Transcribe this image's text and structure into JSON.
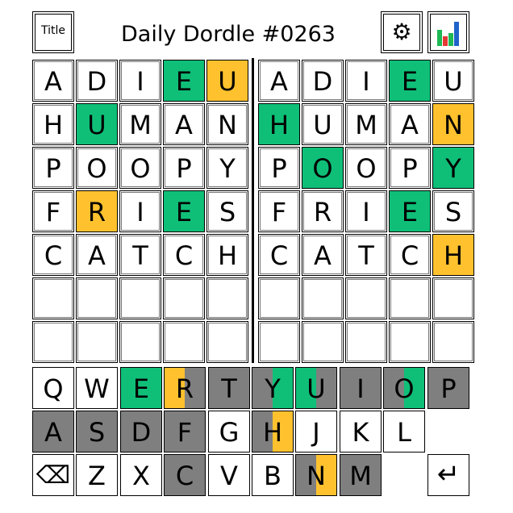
{
  "header": {
    "title_button_label": "Title",
    "game_title": "Daily Dordle #0263",
    "settings_icon": "gear-icon",
    "stats_icon": "bar-chart-icon"
  },
  "colors": {
    "green": "#0fbf78",
    "yellow": "#ffc22e",
    "gray": "#7f7f7f",
    "white": "#ffffff"
  },
  "boards": [
    {
      "rows": [
        [
          {
            "l": "A",
            "s": "none"
          },
          {
            "l": "D",
            "s": "none"
          },
          {
            "l": "I",
            "s": "none"
          },
          {
            "l": "E",
            "s": "green"
          },
          {
            "l": "U",
            "s": "yellow"
          }
        ],
        [
          {
            "l": "H",
            "s": "none"
          },
          {
            "l": "U",
            "s": "green"
          },
          {
            "l": "M",
            "s": "none"
          },
          {
            "l": "A",
            "s": "none"
          },
          {
            "l": "N",
            "s": "none"
          }
        ],
        [
          {
            "l": "P",
            "s": "none"
          },
          {
            "l": "O",
            "s": "none"
          },
          {
            "l": "O",
            "s": "none"
          },
          {
            "l": "P",
            "s": "none"
          },
          {
            "l": "Y",
            "s": "none"
          }
        ],
        [
          {
            "l": "F",
            "s": "none"
          },
          {
            "l": "R",
            "s": "yellow"
          },
          {
            "l": "I",
            "s": "none"
          },
          {
            "l": "E",
            "s": "green"
          },
          {
            "l": "S",
            "s": "none"
          }
        ],
        [
          {
            "l": "C",
            "s": "none"
          },
          {
            "l": "A",
            "s": "none"
          },
          {
            "l": "T",
            "s": "none"
          },
          {
            "l": "C",
            "s": "none"
          },
          {
            "l": "H",
            "s": "none"
          }
        ],
        [
          {
            "l": "",
            "s": "none"
          },
          {
            "l": "",
            "s": "none"
          },
          {
            "l": "",
            "s": "none"
          },
          {
            "l": "",
            "s": "none"
          },
          {
            "l": "",
            "s": "none"
          }
        ],
        [
          {
            "l": "",
            "s": "none"
          },
          {
            "l": "",
            "s": "none"
          },
          {
            "l": "",
            "s": "none"
          },
          {
            "l": "",
            "s": "none"
          },
          {
            "l": "",
            "s": "none"
          }
        ]
      ]
    },
    {
      "rows": [
        [
          {
            "l": "A",
            "s": "none"
          },
          {
            "l": "D",
            "s": "none"
          },
          {
            "l": "I",
            "s": "none"
          },
          {
            "l": "E",
            "s": "green"
          },
          {
            "l": "U",
            "s": "none"
          }
        ],
        [
          {
            "l": "H",
            "s": "green"
          },
          {
            "l": "U",
            "s": "none"
          },
          {
            "l": "M",
            "s": "none"
          },
          {
            "l": "A",
            "s": "none"
          },
          {
            "l": "N",
            "s": "yellow"
          }
        ],
        [
          {
            "l": "P",
            "s": "none"
          },
          {
            "l": "O",
            "s": "green"
          },
          {
            "l": "O",
            "s": "none"
          },
          {
            "l": "P",
            "s": "none"
          },
          {
            "l": "Y",
            "s": "green"
          }
        ],
        [
          {
            "l": "F",
            "s": "none"
          },
          {
            "l": "R",
            "s": "none"
          },
          {
            "l": "I",
            "s": "none"
          },
          {
            "l": "E",
            "s": "green"
          },
          {
            "l": "S",
            "s": "none"
          }
        ],
        [
          {
            "l": "C",
            "s": "none"
          },
          {
            "l": "A",
            "s": "none"
          },
          {
            "l": "T",
            "s": "none"
          },
          {
            "l": "C",
            "s": "none"
          },
          {
            "l": "H",
            "s": "yellow"
          }
        ],
        [
          {
            "l": "",
            "s": "none"
          },
          {
            "l": "",
            "s": "none"
          },
          {
            "l": "",
            "s": "none"
          },
          {
            "l": "",
            "s": "none"
          },
          {
            "l": "",
            "s": "none"
          }
        ],
        [
          {
            "l": "",
            "s": "none"
          },
          {
            "l": "",
            "s": "none"
          },
          {
            "l": "",
            "s": "none"
          },
          {
            "l": "",
            "s": "none"
          },
          {
            "l": "",
            "s": "none"
          }
        ]
      ]
    }
  ],
  "keyboard": [
    [
      {
        "k": "Q",
        "a": "white",
        "b": "white"
      },
      {
        "k": "W",
        "a": "white",
        "b": "white"
      },
      {
        "k": "E",
        "a": "green",
        "b": "green"
      },
      {
        "k": "R",
        "a": "yellow",
        "b": "gray"
      },
      {
        "k": "T",
        "a": "gray",
        "b": "gray"
      },
      {
        "k": "Y",
        "a": "gray",
        "b": "green"
      },
      {
        "k": "U",
        "a": "green",
        "b": "gray"
      },
      {
        "k": "I",
        "a": "gray",
        "b": "gray"
      },
      {
        "k": "O",
        "a": "gray",
        "b": "green"
      },
      {
        "k": "P",
        "a": "gray",
        "b": "gray"
      }
    ],
    [
      {
        "k": "A",
        "a": "gray",
        "b": "gray"
      },
      {
        "k": "S",
        "a": "gray",
        "b": "gray"
      },
      {
        "k": "D",
        "a": "gray",
        "b": "gray"
      },
      {
        "k": "F",
        "a": "gray",
        "b": "gray"
      },
      {
        "k": "G",
        "a": "white",
        "b": "white"
      },
      {
        "k": "H",
        "a": "gray",
        "b": "yellow"
      },
      {
        "k": "J",
        "a": "white",
        "b": "white"
      },
      {
        "k": "K",
        "a": "white",
        "b": "white"
      },
      {
        "k": "L",
        "a": "white",
        "b": "white"
      },
      {
        "k": "",
        "a": "white",
        "b": "white",
        "blank": true
      }
    ],
    [
      {
        "k": "⌫",
        "a": "white",
        "b": "white",
        "special": "backspace"
      },
      {
        "k": "Z",
        "a": "white",
        "b": "white"
      },
      {
        "k": "X",
        "a": "white",
        "b": "white"
      },
      {
        "k": "C",
        "a": "gray",
        "b": "gray"
      },
      {
        "k": "V",
        "a": "white",
        "b": "white"
      },
      {
        "k": "B",
        "a": "white",
        "b": "white"
      },
      {
        "k": "N",
        "a": "gray",
        "b": "yellow"
      },
      {
        "k": "M",
        "a": "gray",
        "b": "gray"
      },
      {
        "k": "",
        "a": "white",
        "b": "white",
        "blank": true
      },
      {
        "k": "↵",
        "a": "white",
        "b": "white",
        "special": "enter"
      }
    ]
  ]
}
